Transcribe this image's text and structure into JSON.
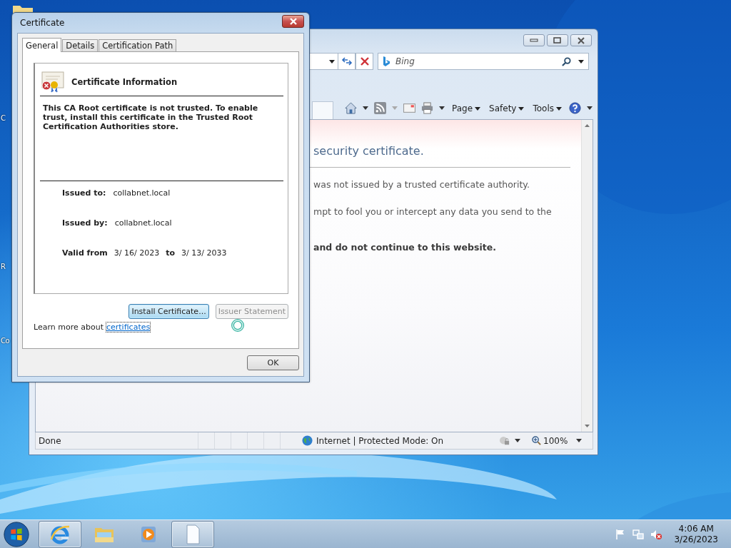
{
  "desktop": {
    "icon_labels": [
      "C",
      "R",
      "Co"
    ]
  },
  "browser": {
    "search": {
      "placeholder": "Bing"
    },
    "command_bar": [
      {
        "label": "Page"
      },
      {
        "label": "Safety"
      },
      {
        "label": "Tools"
      }
    ],
    "content": {
      "heading": "security certificate.",
      "paragraphs": [
        "was not issued by a trusted certificate authority.",
        "mpt to fool you or intercept any data you send to the"
      ],
      "warning": "and do not continue to this website."
    },
    "status_bar": {
      "text": "Done",
      "zone": "Internet | Protected Mode: On",
      "zoom": "100%"
    }
  },
  "dialog": {
    "title": "Certificate",
    "tabs": [
      {
        "label": "General",
        "selected": true
      },
      {
        "label": "Details",
        "selected": false
      },
      {
        "label": "Certification Path",
        "selected": false
      }
    ],
    "heading": "Certificate Information",
    "message": "This CA Root certificate is not trusted. To enable trust, install this certificate in the Trusted Root Certification Authorities store.",
    "fields": [
      {
        "label": "Issued to:",
        "value": "collabnet.local"
      },
      {
        "label": "Issued by:",
        "value": "collabnet.local"
      }
    ],
    "validity": {
      "label": "Valid from",
      "from": "3/ 16/ 2023",
      "separator": "to",
      "to": "3/ 13/ 2033"
    },
    "buttons": [
      {
        "label": "Install Certificate...",
        "disabled": false,
        "focused": true
      },
      {
        "label": "Issuer Statement",
        "disabled": true,
        "focused": false
      }
    ],
    "learn_more": {
      "text": "Learn more about",
      "link": "certificates"
    },
    "ok": "OK"
  },
  "taskbar": {
    "apps": [
      {
        "kind": "ie",
        "active": true
      },
      {
        "kind": "explorer",
        "active": false
      },
      {
        "kind": "media",
        "active": false
      },
      {
        "kind": "document",
        "active": true
      }
    ],
    "clock": {
      "time": "4:06 AM",
      "date": "3/26/2023"
    }
  }
}
